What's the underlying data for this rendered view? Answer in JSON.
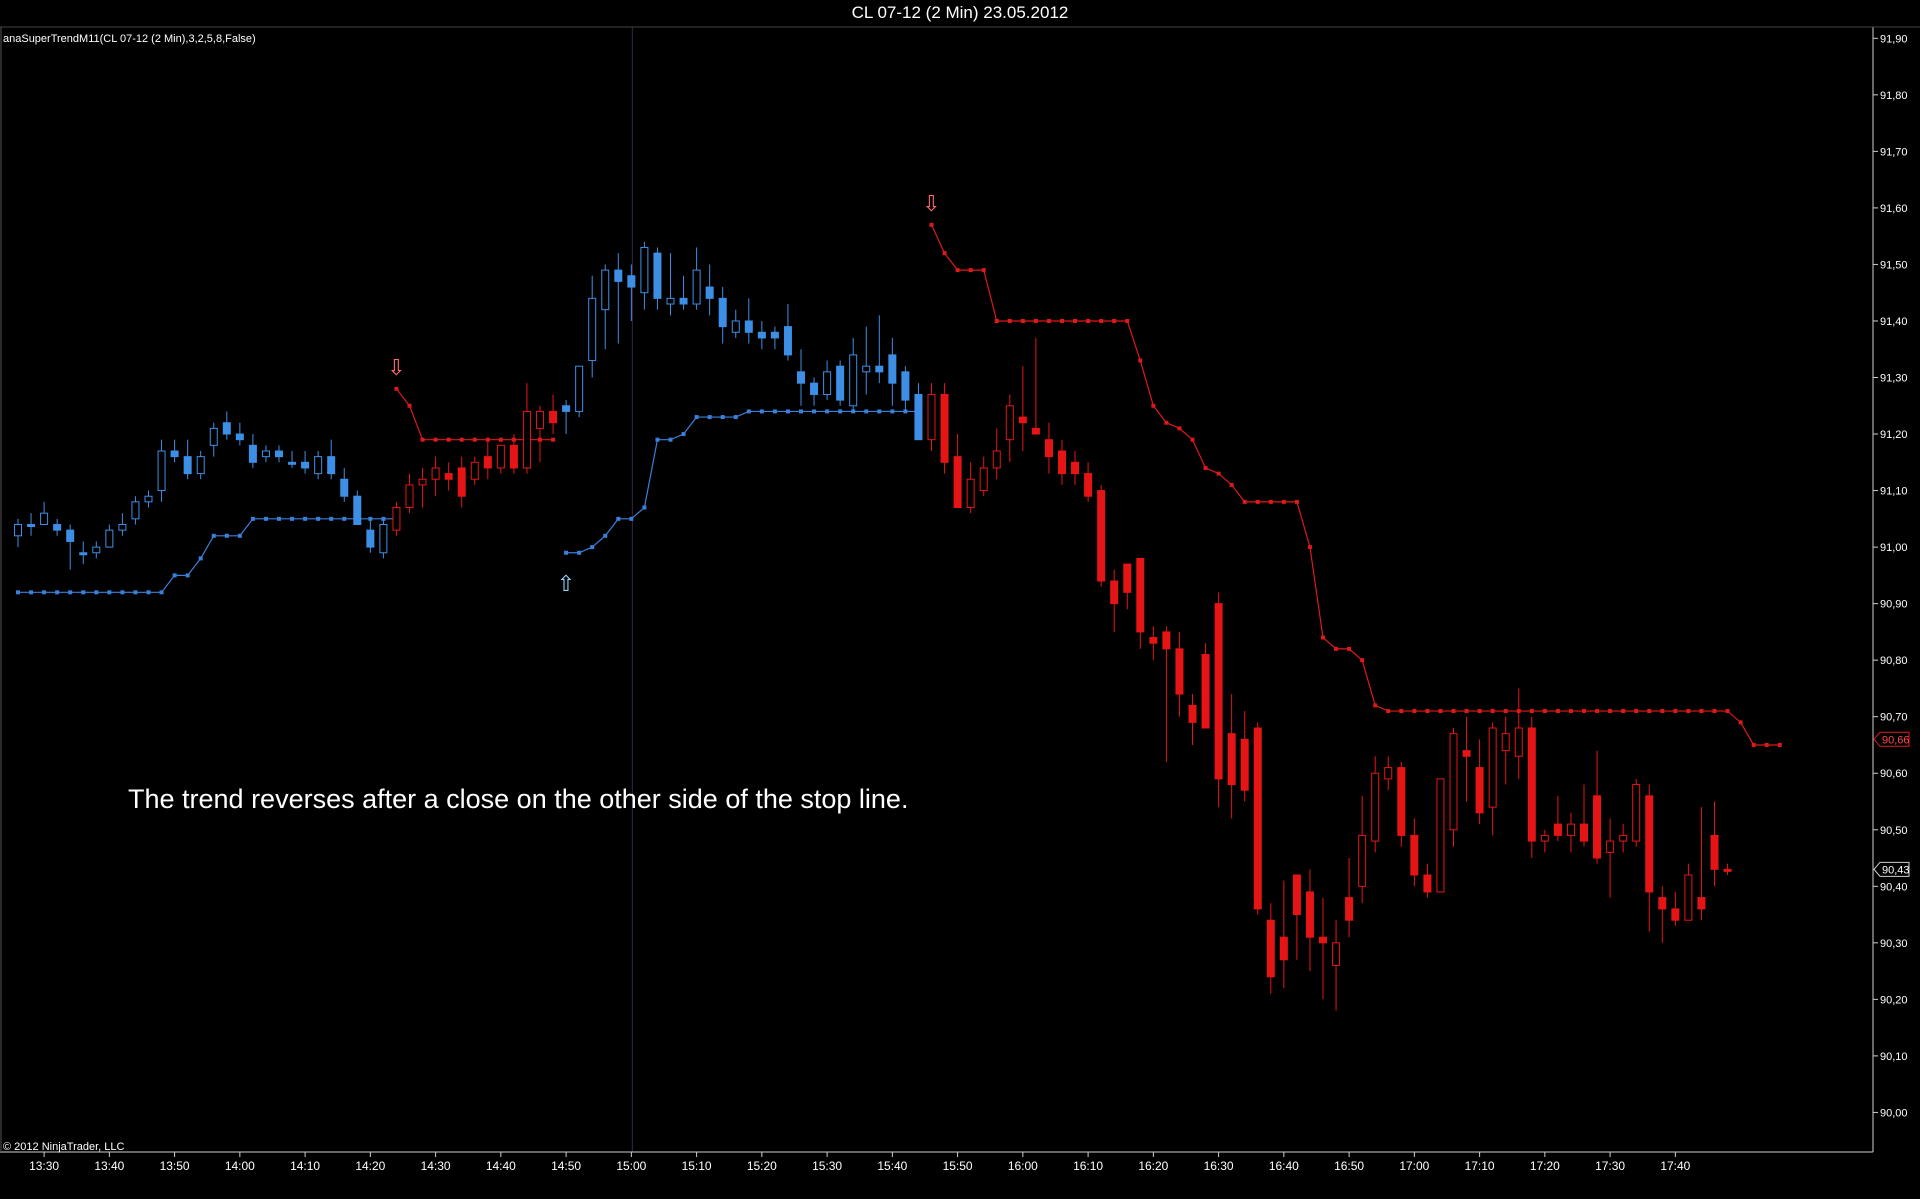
{
  "window": {
    "title": "CL 07-12 (2 Min)  23.05.2012"
  },
  "indicator_label": "anaSuperTrendM11(CL 07-12 (2 Min),3,2,5,8,False)",
  "copyright": "© 2012 NinjaTrader, LLC",
  "annotation": "The trend reverses after a close on the other side of the stop line.",
  "colors": {
    "background": "#000000",
    "up": "#3d8fe6",
    "down": "#e61515",
    "stop_up": "#3a7fd8",
    "stop_down": "#dd1a1a",
    "grid_border": "#ffffff",
    "session_line": "#3a2548"
  },
  "chart_data": {
    "type": "candlestick",
    "ylim": [
      89.93,
      91.92
    ],
    "xlim": [
      -2,
      115
    ],
    "y_ticks": [
      "91,90",
      "91,80",
      "91,70",
      "91,60",
      "91,50",
      "91,40",
      "91,30",
      "91,20",
      "91,10",
      "91,00",
      "90,90",
      "90,80",
      "90,70",
      "90,60",
      "90,50",
      "90,40",
      "90,30",
      "90,20",
      "90,10",
      "90,00"
    ],
    "y_tick_values": [
      91.9,
      91.8,
      91.7,
      91.6,
      91.5,
      91.4,
      91.3,
      91.2,
      91.1,
      91.0,
      90.9,
      90.8,
      90.7,
      90.6,
      90.5,
      90.4,
      90.3,
      90.2,
      90.1,
      90.0
    ],
    "x_ticks": [
      "13:30",
      "13:40",
      "13:50",
      "14:00",
      "14:10",
      "14:20",
      "14:30",
      "14:40",
      "14:50",
      "15:00",
      "15:10",
      "15:20",
      "15:30",
      "15:40",
      "15:50",
      "16:00",
      "16:10",
      "16:20",
      "16:30",
      "16:40",
      "16:50",
      "17:00",
      "17:10",
      "17:20",
      "17:30",
      "17:40"
    ],
    "x_tick_bars": [
      2,
      7,
      12,
      17,
      22,
      27,
      32,
      37,
      42,
      47,
      52,
      57,
      62,
      67,
      72,
      77,
      82,
      87,
      92,
      97,
      102,
      107,
      112,
      117,
      122,
      127
    ],
    "session_break_bar": 47,
    "price_markers": [
      {
        "label": "90,66",
        "value": 90.66,
        "type": "stop"
      },
      {
        "label": "90,43",
        "value": 90.43,
        "type": "last"
      }
    ],
    "candles": [
      [
        91.02,
        91.05,
        91.0,
        91.04
      ],
      [
        91.04,
        91.06,
        91.02,
        91.04
      ],
      [
        91.04,
        91.08,
        91.04,
        91.06
      ],
      [
        91.04,
        91.05,
        91.02,
        91.03
      ],
      [
        91.03,
        91.04,
        90.96,
        91.01
      ],
      [
        90.99,
        91.01,
        90.97,
        90.99
      ],
      [
        90.99,
        91.01,
        90.98,
        91.0
      ],
      [
        91.0,
        91.04,
        91.0,
        91.03
      ],
      [
        91.03,
        91.06,
        91.02,
        91.04
      ],
      [
        91.05,
        91.09,
        91.04,
        91.08
      ],
      [
        91.08,
        91.1,
        91.07,
        91.09
      ],
      [
        91.1,
        91.19,
        91.08,
        91.17
      ],
      [
        91.17,
        91.19,
        91.15,
        91.16
      ],
      [
        91.16,
        91.19,
        91.12,
        91.13
      ],
      [
        91.13,
        91.17,
        91.12,
        91.16
      ],
      [
        91.18,
        91.22,
        91.16,
        91.21
      ],
      [
        91.22,
        91.24,
        91.19,
        91.2
      ],
      [
        91.2,
        91.22,
        91.18,
        91.19
      ],
      [
        91.18,
        91.2,
        91.14,
        91.15
      ],
      [
        91.16,
        91.18,
        91.15,
        91.17
      ],
      [
        91.17,
        91.18,
        91.15,
        91.16
      ],
      [
        91.15,
        91.17,
        91.14,
        91.15
      ],
      [
        91.15,
        91.17,
        91.13,
        91.14
      ],
      [
        91.13,
        91.17,
        91.12,
        91.16
      ],
      [
        91.16,
        91.19,
        91.12,
        91.13
      ],
      [
        91.12,
        91.14,
        91.08,
        91.09
      ],
      [
        91.09,
        91.1,
        91.04,
        91.04
      ],
      [
        91.03,
        91.05,
        90.99,
        91.0
      ],
      [
        90.99,
        91.05,
        90.98,
        91.04
      ],
      [
        91.03,
        91.08,
        91.02,
        91.07
      ],
      [
        91.07,
        91.13,
        91.06,
        91.11
      ],
      [
        91.11,
        91.14,
        91.07,
        91.12
      ],
      [
        91.12,
        91.16,
        91.09,
        91.14
      ],
      [
        91.13,
        91.15,
        91.1,
        91.12
      ],
      [
        91.14,
        91.16,
        91.07,
        91.09
      ],
      [
        91.12,
        91.16,
        91.11,
        91.15
      ],
      [
        91.16,
        91.19,
        91.12,
        91.14
      ],
      [
        91.14,
        91.18,
        91.13,
        91.18
      ],
      [
        91.18,
        91.2,
        91.13,
        91.14
      ],
      [
        91.14,
        91.29,
        91.13,
        91.24
      ],
      [
        91.21,
        91.25,
        91.15,
        91.24
      ],
      [
        91.24,
        91.27,
        91.2,
        91.22
      ],
      [
        91.25,
        91.26,
        91.2,
        91.24
      ],
      [
        91.24,
        91.32,
        91.23,
        91.32
      ],
      [
        91.33,
        91.48,
        91.3,
        91.44
      ],
      [
        91.42,
        91.5,
        91.35,
        91.49
      ],
      [
        91.49,
        91.52,
        91.36,
        91.47
      ],
      [
        91.48,
        91.5,
        91.4,
        91.46
      ],
      [
        91.45,
        91.54,
        91.42,
        91.53
      ],
      [
        91.52,
        91.53,
        91.42,
        91.44
      ],
      [
        91.43,
        91.52,
        91.41,
        91.44
      ],
      [
        91.44,
        91.48,
        91.42,
        91.43
      ],
      [
        91.43,
        91.53,
        91.42,
        91.49
      ],
      [
        91.46,
        91.5,
        91.41,
        91.44
      ],
      [
        91.44,
        91.46,
        91.36,
        91.39
      ],
      [
        91.38,
        91.42,
        91.37,
        91.4
      ],
      [
        91.4,
        91.44,
        91.36,
        91.38
      ],
      [
        91.38,
        91.4,
        91.35,
        91.37
      ],
      [
        91.38,
        91.39,
        91.35,
        91.37
      ],
      [
        91.39,
        91.43,
        91.33,
        91.34
      ],
      [
        91.31,
        91.35,
        91.25,
        91.29
      ],
      [
        91.29,
        91.3,
        91.25,
        91.27
      ],
      [
        91.27,
        91.33,
        91.26,
        91.31
      ],
      [
        91.32,
        91.33,
        91.25,
        91.26
      ],
      [
        91.25,
        91.37,
        91.24,
        91.34
      ],
      [
        91.31,
        91.39,
        91.27,
        91.32
      ],
      [
        91.32,
        91.41,
        91.29,
        91.31
      ],
      [
        91.34,
        91.37,
        91.25,
        91.29
      ],
      [
        91.31,
        91.32,
        91.24,
        91.26
      ],
      [
        91.27,
        91.29,
        91.2,
        91.19
      ],
      [
        91.19,
        91.29,
        91.17,
        91.27
      ],
      [
        91.27,
        91.29,
        91.13,
        91.15
      ],
      [
        91.16,
        91.2,
        91.08,
        91.07
      ],
      [
        91.07,
        91.15,
        91.06,
        91.12
      ],
      [
        91.1,
        91.16,
        91.09,
        91.14
      ],
      [
        91.14,
        91.21,
        91.12,
        91.17
      ],
      [
        91.19,
        91.27,
        91.15,
        91.25
      ],
      [
        91.23,
        91.32,
        91.17,
        91.22
      ],
      [
        91.21,
        91.37,
        91.21,
        91.2
      ],
      [
        91.19,
        91.22,
        91.13,
        91.16
      ],
      [
        91.17,
        91.19,
        91.11,
        91.13
      ],
      [
        91.15,
        91.17,
        91.11,
        91.13
      ],
      [
        91.13,
        91.15,
        91.08,
        91.09
      ],
      [
        91.1,
        91.11,
        90.93,
        90.94
      ],
      [
        90.94,
        90.96,
        90.85,
        90.9
      ],
      [
        90.97,
        90.97,
        90.89,
        90.92
      ],
      [
        90.98,
        90.98,
        90.82,
        90.85
      ],
      [
        90.84,
        90.86,
        90.8,
        90.83
      ],
      [
        90.85,
        90.86,
        90.62,
        90.82
      ],
      [
        90.82,
        90.85,
        90.7,
        90.74
      ],
      [
        90.72,
        90.74,
        90.65,
        90.69
      ],
      [
        90.81,
        90.83,
        90.68,
        90.68
      ],
      [
        90.9,
        90.92,
        90.54,
        90.59
      ],
      [
        90.67,
        90.74,
        90.52,
        90.58
      ],
      [
        90.66,
        90.71,
        90.55,
        90.57
      ],
      [
        90.68,
        90.69,
        90.35,
        90.36
      ],
      [
        90.34,
        90.37,
        90.21,
        90.24
      ],
      [
        90.31,
        90.41,
        90.22,
        90.27
      ],
      [
        90.42,
        90.42,
        90.27,
        90.35
      ],
      [
        90.39,
        90.43,
        90.25,
        90.31
      ],
      [
        90.31,
        90.38,
        90.2,
        90.3
      ],
      [
        90.26,
        90.34,
        90.18,
        90.3
      ],
      [
        90.38,
        90.45,
        90.31,
        90.34
      ],
      [
        90.4,
        90.56,
        90.37,
        90.49
      ],
      [
        90.48,
        90.63,
        90.46,
        90.6
      ],
      [
        90.59,
        90.63,
        90.57,
        90.61
      ],
      [
        90.61,
        90.62,
        90.47,
        90.49
      ],
      [
        90.49,
        90.52,
        90.4,
        90.42
      ],
      [
        90.42,
        90.44,
        90.38,
        90.39
      ],
      [
        90.39,
        90.59,
        90.39,
        90.59
      ],
      [
        90.5,
        90.68,
        90.47,
        90.67
      ],
      [
        90.64,
        90.7,
        90.55,
        90.63
      ],
      [
        90.61,
        90.66,
        90.51,
        90.53
      ],
      [
        90.54,
        90.69,
        90.49,
        90.68
      ],
      [
        90.64,
        90.7,
        90.58,
        90.67
      ],
      [
        90.63,
        90.75,
        90.59,
        90.68
      ],
      [
        90.68,
        90.7,
        90.45,
        90.48
      ],
      [
        90.48,
        90.5,
        90.46,
        90.49
      ],
      [
        90.51,
        90.56,
        90.48,
        90.49
      ],
      [
        90.49,
        90.53,
        90.46,
        90.51
      ],
      [
        90.51,
        90.58,
        90.47,
        90.48
      ],
      [
        90.56,
        90.64,
        90.44,
        90.45
      ],
      [
        90.46,
        90.52,
        90.38,
        90.48
      ],
      [
        90.48,
        90.51,
        90.46,
        90.49
      ],
      [
        90.48,
        90.59,
        90.47,
        90.58
      ],
      [
        90.56,
        90.58,
        90.32,
        90.39
      ],
      [
        90.38,
        90.4,
        90.3,
        90.36
      ],
      [
        90.36,
        90.39,
        90.33,
        90.34
      ],
      [
        90.34,
        90.44,
        90.34,
        90.42
      ],
      [
        90.38,
        90.54,
        90.34,
        90.36
      ],
      [
        90.49,
        90.55,
        90.4,
        90.43
      ],
      [
        90.43,
        90.44,
        90.42,
        90.43
      ]
    ],
    "stop_line": [
      {
        "side": "up",
        "start": 0,
        "values": [
          90.92,
          90.92,
          90.92,
          90.92,
          90.92,
          90.92,
          90.92,
          90.92,
          90.92,
          90.92,
          90.92,
          90.92,
          90.95,
          90.95,
          90.98,
          91.02,
          91.02,
          91.02,
          91.05,
          91.05,
          91.05,
          91.05,
          91.05,
          91.05,
          91.05,
          91.05,
          91.05,
          91.05,
          91.05,
          91.05
        ]
      },
      {
        "side": "down",
        "start": 29,
        "values": [
          91.28,
          91.25,
          91.19,
          91.19,
          91.19,
          91.19,
          91.19,
          91.19,
          91.19,
          91.19,
          91.19,
          91.19,
          91.19
        ]
      },
      {
        "side": "up",
        "start": 42,
        "values": [
          90.99,
          90.99,
          91.0,
          91.02,
          91.05,
          91.05,
          91.07,
          91.19,
          91.19,
          91.2,
          91.23,
          91.23,
          91.23,
          91.23,
          91.24,
          91.24,
          91.24,
          91.24,
          91.24,
          91.24,
          91.24,
          91.24,
          91.24,
          91.24,
          91.24,
          91.24,
          91.24,
          91.24
        ]
      },
      {
        "side": "down",
        "start": 70,
        "values": [
          91.57,
          91.52,
          91.49,
          91.49,
          91.49,
          91.4,
          91.4,
          91.4,
          91.4,
          91.4,
          91.4,
          91.4,
          91.4,
          91.4,
          91.4,
          91.4,
          91.33,
          91.25,
          91.22,
          91.21,
          91.19,
          91.14,
          91.13,
          91.11,
          91.08,
          91.08,
          91.08,
          91.08,
          91.08,
          91.0,
          90.84,
          90.82,
          90.82,
          90.8,
          90.72,
          90.71,
          90.71,
          90.71,
          90.71,
          90.71,
          90.71,
          90.71,
          90.71,
          90.71,
          90.71,
          90.71,
          90.71,
          90.71,
          90.71,
          90.71,
          90.71,
          90.71,
          90.71,
          90.71,
          90.71,
          90.71,
          90.71,
          90.71,
          90.71,
          90.71,
          90.71,
          90.71,
          90.69,
          90.65,
          90.65,
          90.65
        ]
      }
    ],
    "signals": [
      {
        "bar": 29,
        "dir": "down",
        "label": "⇩"
      },
      {
        "bar": 42,
        "dir": "up",
        "label": "⇧"
      },
      {
        "bar": 70,
        "dir": "down",
        "label": "⇩"
      }
    ]
  }
}
